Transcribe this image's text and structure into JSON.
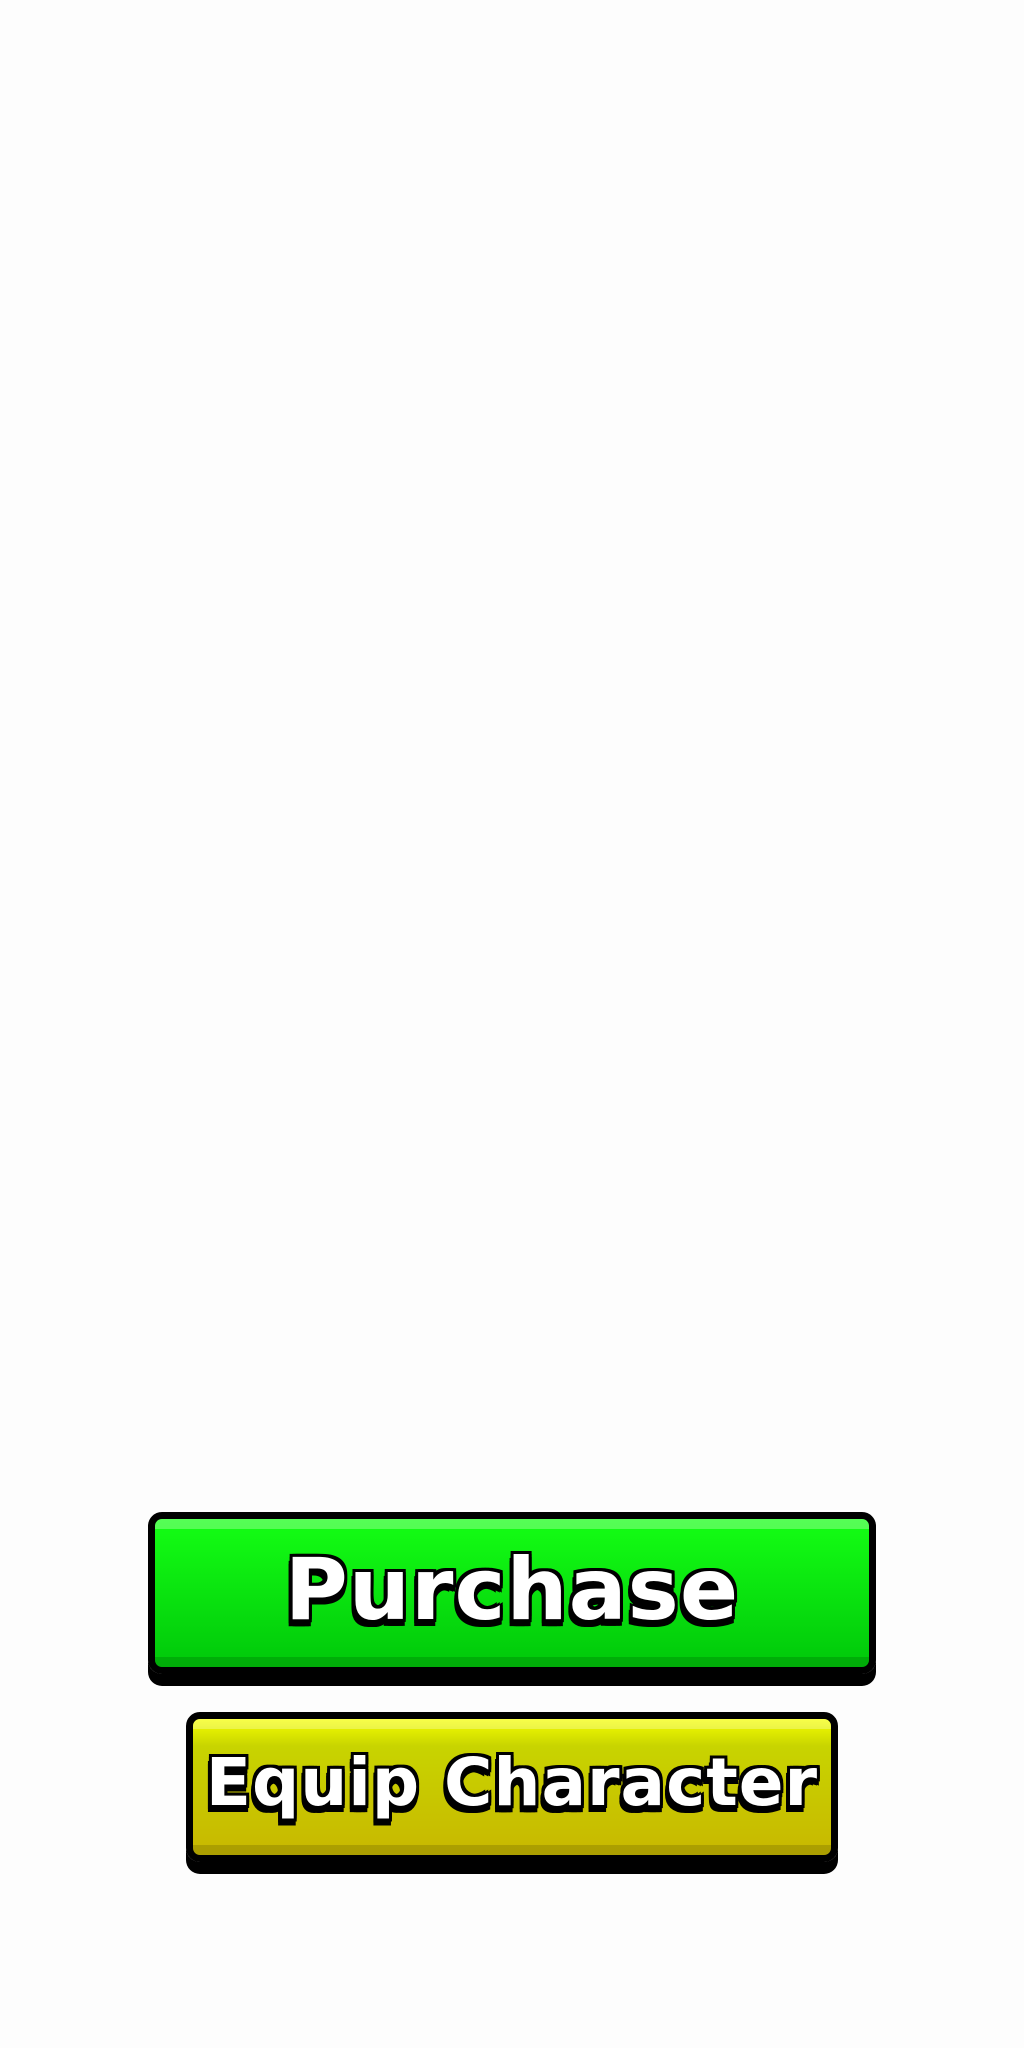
{
  "buttons": {
    "purchase": {
      "label": "Purchase",
      "color_top": "#14ff14",
      "color_bottom": "#00c80a"
    },
    "equip": {
      "label": "Equip Character",
      "color_top": "#f5ff00",
      "color_bottom": "#c8b800"
    }
  }
}
